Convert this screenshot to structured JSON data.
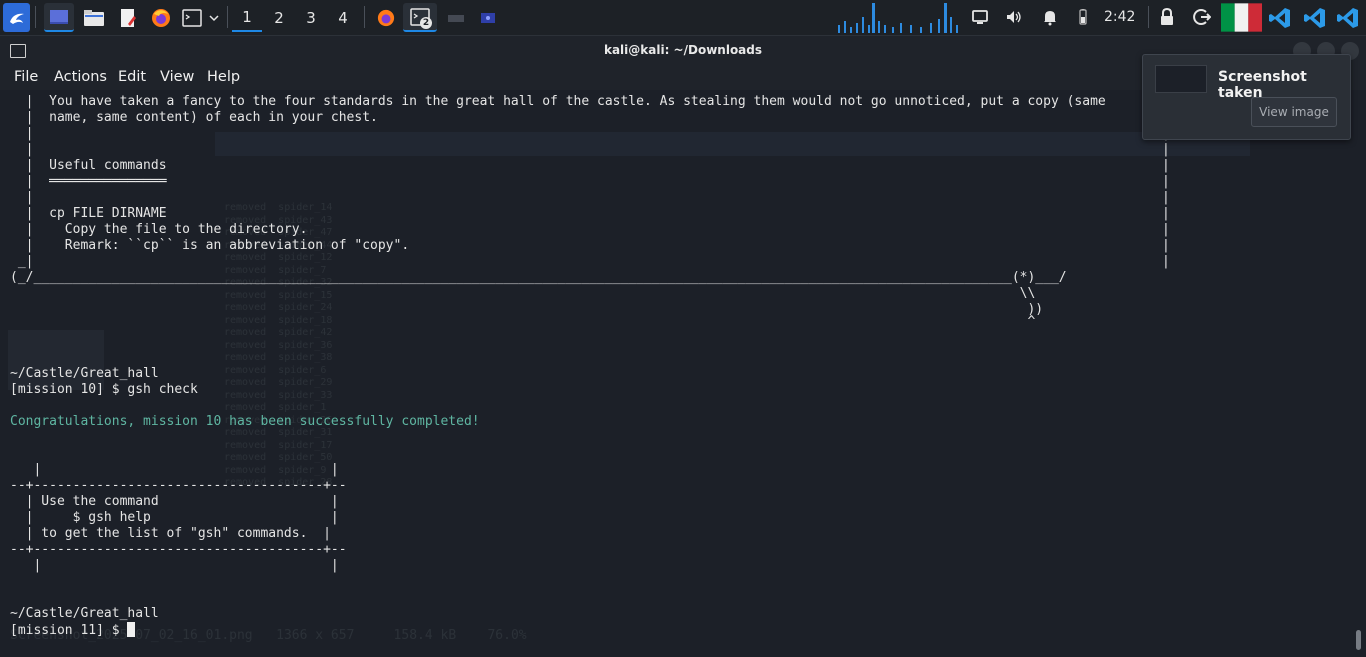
{
  "taskbar": {
    "workspaces": [
      "1",
      "2",
      "3",
      "4"
    ],
    "terminal_badge": "2",
    "clock": "2:42",
    "colors": {
      "accent": "#1e88e5",
      "flag_green": "#009246",
      "flag_white": "#f1f2f1",
      "flag_red": "#ce2b37",
      "vscode": "#2c9ae8"
    }
  },
  "window": {
    "title": "kali@kali: ~/Downloads",
    "menu": [
      "File",
      "Actions",
      "Edit",
      "View",
      "Help"
    ]
  },
  "terminal": {
    "lines": [
      "  |  You have taken a fancy to the four standards in the great hall of the castle. As stealing them would not go unnoticed, put a copy (same",
      "  |  name, same content) of each in your chest.",
      "  |",
      "  |",
      "  |  Useful commands",
      "  |  ═══════════════",
      "  |",
      "  |  cp FILE DIRNAME",
      "  |    Copy the file to the directory.",
      "  |    Remark: ``cp`` is an abbreviation of \"copy\".",
      " _|",
      "(_/_____________________________________________________________________________________________________________________________(*)___/",
      "                                                                                                                                 \\\\",
      "                                                                                                                                  ))",
      "                                                                                                                                  ^",
      "",
      "",
      "~/Castle/Great_hall",
      "[mission 10] $ gsh check",
      "",
      "Congratulations, mission 10 has been successfully completed!",
      "",
      "",
      "   |                                     |",
      "--+-------------------------------------+--",
      "  | Use the command                      |",
      "  |     $ gsh help                       |",
      "  | to get the list of \"gsh\" commands.  |",
      "--+-------------------------------------+--",
      "   |                                     |",
      "",
      "~/Castle/Great_hall",
      "[mission 11] $ "
    ],
    "right_border_lines": [
      "|",
      "|",
      "|",
      "|",
      "|",
      "|",
      "|",
      "|",
      "|",
      "|"
    ]
  },
  "notification": {
    "title": "Screenshot taken",
    "button": "View image"
  },
  "background_image": {
    "filename": "Screenshot_2025-07_02_16_01.png",
    "dimensions": "1366 x 657",
    "size": "158.4 kB",
    "zoom": "76.0%"
  }
}
